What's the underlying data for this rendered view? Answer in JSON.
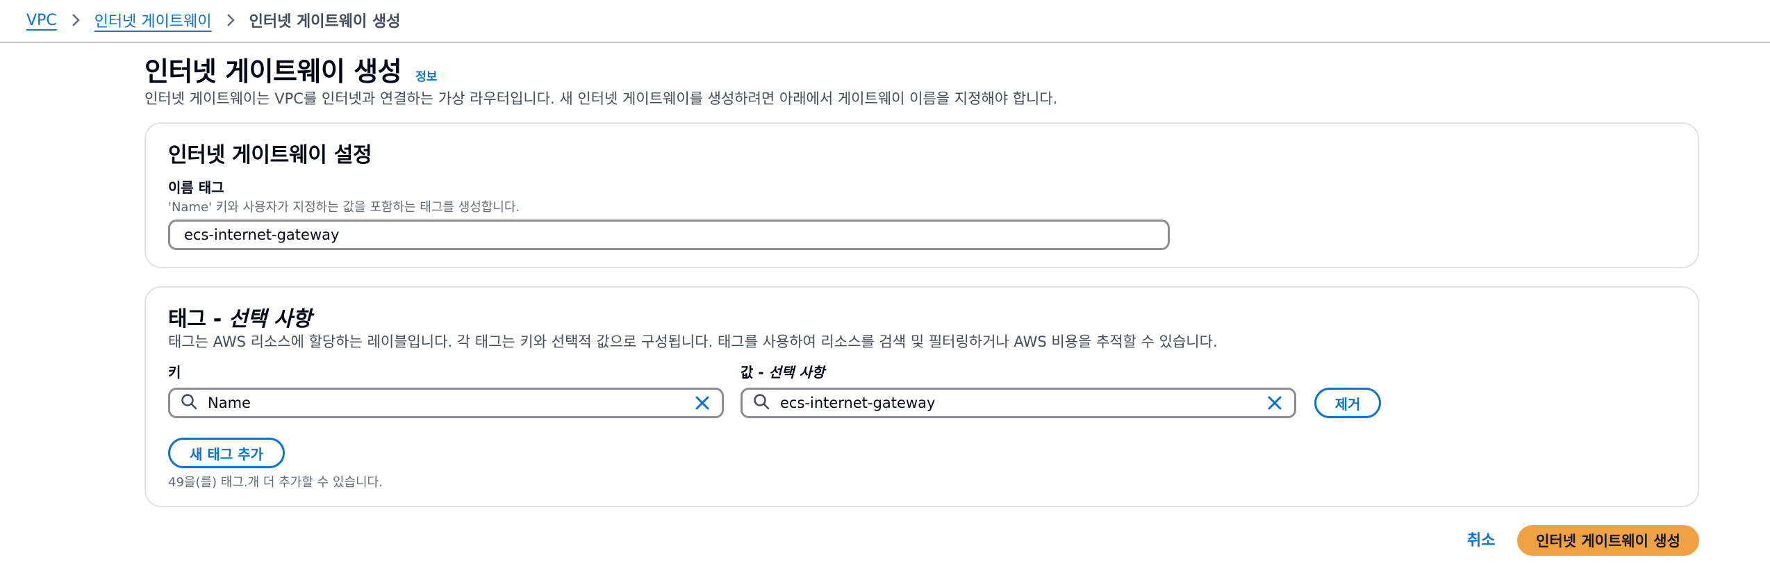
{
  "breadcrumb": {
    "items": [
      {
        "label": "VPC"
      },
      {
        "label": "인터넷 게이트웨이"
      },
      {
        "label": "인터넷 게이트웨이 생성"
      }
    ]
  },
  "page": {
    "title": "인터넷 게이트웨이 생성",
    "info_link": "정보",
    "description": "인터넷 게이트웨이는 VPC를 인터넷과 연결하는 가상 라우터입니다. 새 인터넷 게이트웨이를 생성하려면 아래에서 게이트웨이 이름을 지정해야 합니다."
  },
  "settings": {
    "heading": "인터넷 게이트웨이 설정",
    "name_tag_label": "이름 태그",
    "name_tag_hint": "'Name' 키와 사용자가 지정하는 값을 포함하는 태그를 생성합니다.",
    "name_tag_value": "ecs-internet-gateway"
  },
  "tags": {
    "heading_main": "태그 - ",
    "heading_optional": "선택 사항",
    "description": "태그는 AWS 리소스에 할당하는 레이블입니다. 각 태그는 키와 선택적 값으로 구성됩니다. 태그를 사용하여 리소스를 검색 및 필터링하거나 AWS 비용을 추적할 수 있습니다.",
    "key_label": "키",
    "value_label_main": "값 - ",
    "value_label_optional": "선택 사항",
    "rows": [
      {
        "key": "Name",
        "value": "ecs-internet-gateway",
        "remove_label": "제거"
      }
    ],
    "add_button": "새 태그 추가",
    "limit_note": "49을(를) 태그.개 더 추가할 수 있습니다."
  },
  "footer": {
    "cancel": "취소",
    "submit": "인터넷 게이트웨이 생성"
  },
  "colors": {
    "link": "#0972d3",
    "primary_button": "#f0a243",
    "border": "#dfe3e8"
  },
  "icons": [
    "chevron-right-icon",
    "search-icon",
    "close-icon"
  ]
}
